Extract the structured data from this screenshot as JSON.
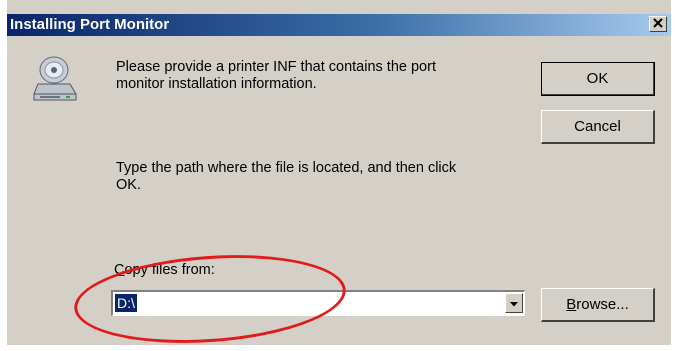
{
  "window": {
    "title": "Installing Port Monitor"
  },
  "message": {
    "line1": "Please provide a printer INF that contains the port",
    "line2": "monitor installation information."
  },
  "instruction": {
    "line1": "Type the path where the file is located, and then click",
    "line2": "OK."
  },
  "buttons": {
    "ok": "OK",
    "cancel": "Cancel"
  },
  "copy_files": {
    "label_mnemonic": "C",
    "label_rest": "opy files from:",
    "value": "D:\\"
  },
  "browse": {
    "mnemonic": "B",
    "rest": "rowse..."
  },
  "icons": {
    "close": "close-icon",
    "disk": "disk-drive-icon",
    "dropdown": "chevron-down-icon"
  },
  "colors": {
    "titlebar_start": "#0a246a",
    "titlebar_end": "#a6caf0",
    "annotation": "#e21a1a",
    "dialog_bg": "#d4d0c8"
  }
}
